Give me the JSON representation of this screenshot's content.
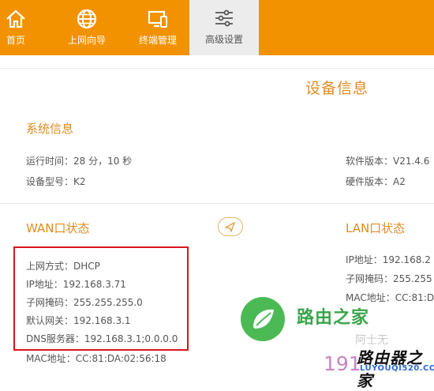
{
  "nav": {
    "items": [
      {
        "label": "首页",
        "icon": "home-icon"
      },
      {
        "label": "上网向导",
        "icon": "globe-icon"
      },
      {
        "label": "终端管理",
        "icon": "devices-icon"
      },
      {
        "label": "高级设置",
        "icon": "sliders-icon"
      }
    ],
    "active_index": 3
  },
  "page": {
    "title": "设备信息"
  },
  "system": {
    "title": "系统信息",
    "uptime": "运行时间：28 分，10 秒",
    "model": "设备型号：K2",
    "software": "软件版本：V21.4.6",
    "hardware": "硬件版本：A2"
  },
  "wan": {
    "title": "WAN口状态",
    "mode": "上网方式：DHCP",
    "ip": "IP地址：192.168.3.71",
    "mask": "子网掩码：255.255.255.0",
    "gateway": "默认网关：192.168.3.1",
    "dns": "DNS服务器：192.168.3.1;0.0.0.0",
    "mac": "MAC地址：CC:81:DA:02:56:18"
  },
  "lan": {
    "title": "LAN口状态",
    "ip": "IP地址：192.168.2",
    "mask": "子网掩码：255.255",
    "mac": "MAC地址：CC:81:D"
  },
  "watermark": {
    "brand": "路由之家",
    "url_partial": "191",
    "stamp": "路由器之家",
    "stamp_url": "LUYOUQI520.COM",
    "faint": "阿士无"
  },
  "colors": {
    "accent": "#f29200",
    "heading": "#e08b1f",
    "highlight_border": "#d9141c"
  }
}
